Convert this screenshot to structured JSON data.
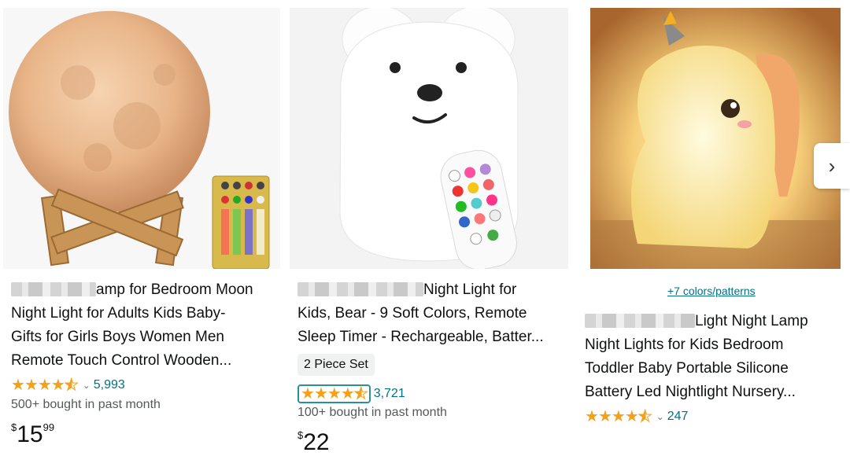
{
  "products": [
    {
      "title_lines": [
        "amp for Bedroom Moon",
        "Night Light for Adults Kids Baby-",
        "Gifts for Girls Boys Women Men",
        "Remote Touch Control Wooden..."
      ],
      "rating_count": "5,993",
      "bought": "500+ bought in past month",
      "price_currency": "$",
      "price_whole": "15",
      "price_cents": "99"
    },
    {
      "title_lines": [
        "Night Light for",
        "Kids, Bear - 9 Soft Colors, Remote",
        "Sleep Timer - Rechargeable, Batter..."
      ],
      "badge": "2 Piece Set",
      "rating_count": "3,721",
      "bought": "100+ bought in past month",
      "price_currency": "$",
      "price_whole": "22"
    },
    {
      "colors_link": "+7 colors/patterns",
      "title_lines": [
        "Light Night Lamp",
        "Night Lights for Kids Bedroom",
        "Toddler Baby Portable Silicone",
        "Battery Led Nightlight Nursery..."
      ],
      "rating_count": "247"
    }
  ],
  "rating_stars": 4.5,
  "icons": {
    "star": "★",
    "caret": "⌄",
    "next": "›"
  },
  "colors": {
    "star": "#f5a01a",
    "link": "#007185",
    "text": "#0f1111",
    "muted": "#565959"
  }
}
